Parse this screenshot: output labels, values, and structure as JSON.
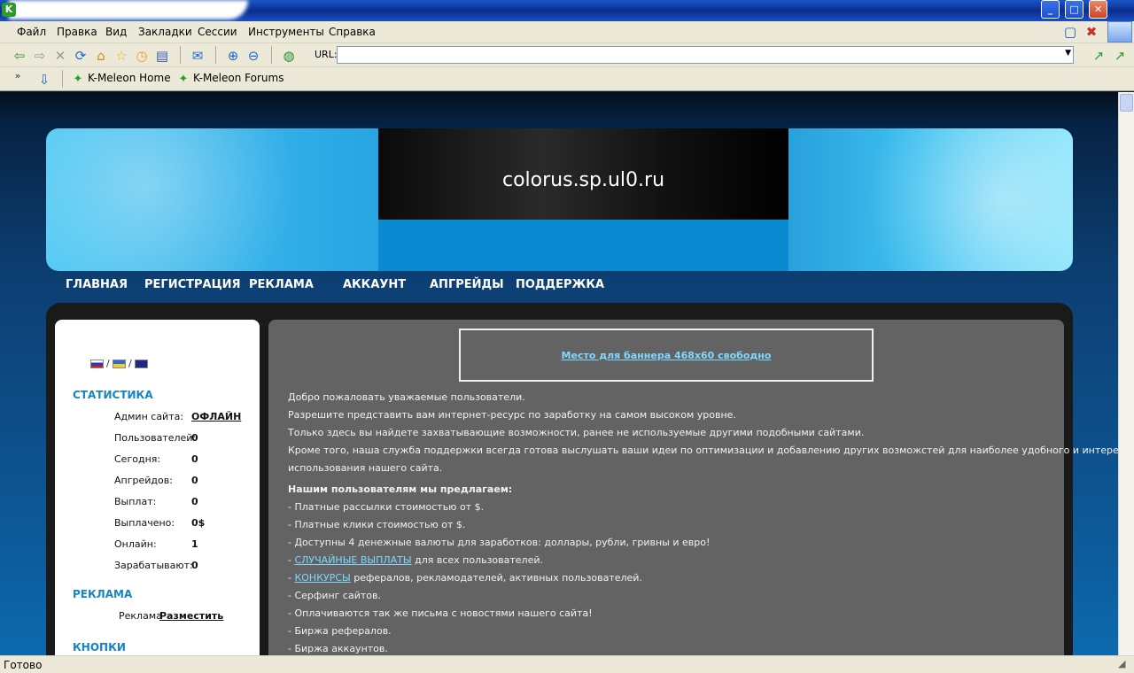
{
  "menubar": {
    "items": [
      "Файл",
      "Правка",
      "Вид",
      "Закладки",
      "Сессии",
      "Инструменты",
      "Справка"
    ]
  },
  "toolbar": {
    "url_label": "URL:",
    "url_value": ""
  },
  "bookmarks": {
    "items": [
      "K-Meleon Home",
      "K-Meleon Forums"
    ]
  },
  "site": {
    "title": "colorus.sp.ul0.ru",
    "nav": [
      "ГЛАВНАЯ",
      "РЕГИСТРАЦИЯ",
      "РЕКЛАМА",
      "АККАУНТ",
      "АПГРЕЙДЫ",
      "ПОДДЕРЖКА"
    ]
  },
  "sidebar": {
    "stats_heading": "СТАТИСТИКА",
    "stats": [
      {
        "label": "Админ сайта:",
        "value": "ОФЛАЙН"
      },
      {
        "label": "Пользователей:",
        "value": "0"
      },
      {
        "label": "Сегодня:",
        "value": "0"
      },
      {
        "label": "Апгрейдов:",
        "value": "0"
      },
      {
        "label": "Выплат:",
        "value": "0"
      },
      {
        "label": "Выплачено:",
        "value": "0$"
      },
      {
        "label": "Онлайн:",
        "value": "1"
      },
      {
        "label": "Зарабатывают:",
        "value": "0"
      }
    ],
    "ads_heading": "РЕКЛАМА",
    "ads_text": "Реклама",
    "ads_link": "Разместить",
    "buttons_heading": "КНОПКИ"
  },
  "content": {
    "banner_link": "Место для баннера 468x60 свободно",
    "intro": [
      "Добро пожаловать уважаемые пользователи.",
      "Разрешите представить вам интернет-ресурс по заработку на самом высоком уровне.",
      "Только здесь вы найдете захватывающие возможности, ранее не используемые другими подобными сайтами.",
      "Кроме того, наша служба поддержки всегда готова выслушать ваши идеи по оптимизации и добавлению других возможстей для наиболее удобного и интересного",
      "использования нашего сайта."
    ],
    "offer_heading": "Нашим пользователям мы предлагаем:",
    "offers": [
      "- Платные рассылки стоимостью от $.",
      "- Платные клики стоимостью от $.",
      "- Доступны 4 денежные валюты для заработков: доллары, рубли, гривны и евро!"
    ],
    "random_link": "СЛУЧАЙНЫЕ ВЫПЛАТЫ",
    "random_rest": " для всех пользователей.",
    "contests_link": "КОНКУРСЫ",
    "contests_rest": " рефералов, рекламодателей, активных пользователей.",
    "offers2": [
      "- Серфинг сайтов.",
      "- Оплачиваются так же письма с новостями нашего сайта!",
      "- Биржа рефералов.",
      "- Биржа аккаунтов."
    ],
    "dash": "- "
  },
  "status": {
    "text": "Готово"
  }
}
